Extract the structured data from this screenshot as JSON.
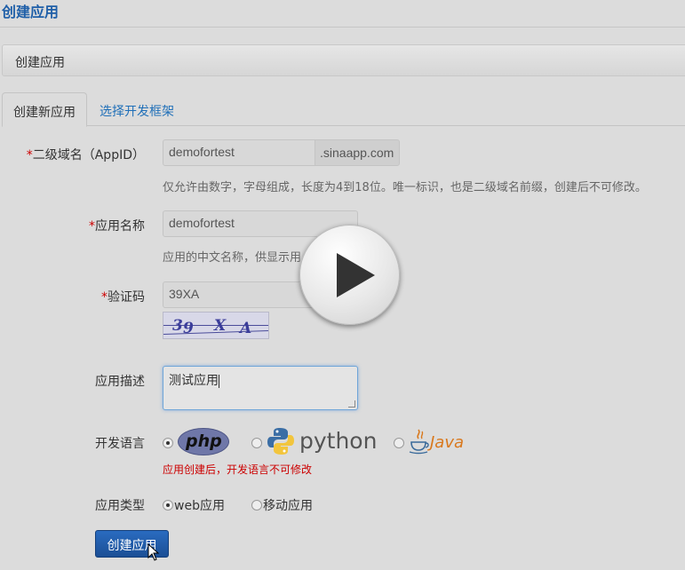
{
  "page": {
    "title": "创建应用"
  },
  "breadcrumb": {
    "label": "创建应用"
  },
  "tabs": [
    {
      "label": "创建新应用",
      "active": true
    },
    {
      "label": "选择开发框架",
      "active": false
    }
  ],
  "form": {
    "appid": {
      "required_mark": "*",
      "label": "二级域名（AppID）",
      "value": "demofortest",
      "suffix": ".sinaapp.com",
      "help": "仅允许由数字，字母组成，长度为4到18位。唯一标识，也是二级域名前缀，创建后不可修改。"
    },
    "app_name": {
      "required_mark": "*",
      "label": "应用名称",
      "value": "demofortest",
      "help": "应用的中文名称，供显示用"
    },
    "captcha": {
      "required_mark": "*",
      "label": "验证码",
      "value": "39XA",
      "image_chars": [
        "3",
        "9",
        "X",
        "A"
      ]
    },
    "description": {
      "label": "应用描述",
      "value": "测试应用"
    },
    "language": {
      "label": "开发语言",
      "options": [
        {
          "name": "php",
          "icon": "php-logo",
          "selected": true
        },
        {
          "name": "python",
          "icon": "python-logo",
          "selected": false
        },
        {
          "name": "Java",
          "icon": "java-logo",
          "selected": false
        }
      ],
      "warning": "应用创建后，开发语言不可修改"
    },
    "app_type": {
      "label": "应用类型",
      "options": [
        {
          "label": "web应用",
          "selected": true
        },
        {
          "label": "移动应用",
          "selected": false
        }
      ]
    },
    "submit_label": "创建应用"
  },
  "overlay": {
    "icon": "play-icon"
  },
  "colors": {
    "title_blue": "#1f5fa8",
    "link_blue": "#1f6fb8",
    "required_red": "#cc0000",
    "button_blue": "#1b4f95",
    "java_orange": "#d9781c"
  }
}
